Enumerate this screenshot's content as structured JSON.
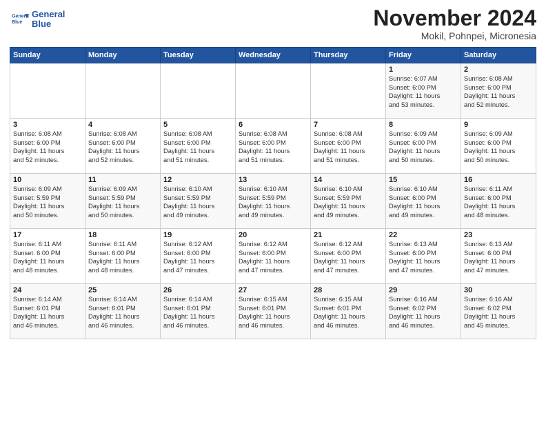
{
  "header": {
    "logo_line1": "General",
    "logo_line2": "Blue",
    "month": "November 2024",
    "location": "Mokil, Pohnpei, Micronesia"
  },
  "weekdays": [
    "Sunday",
    "Monday",
    "Tuesday",
    "Wednesday",
    "Thursday",
    "Friday",
    "Saturday"
  ],
  "weeks": [
    [
      {
        "day": "",
        "info": ""
      },
      {
        "day": "",
        "info": ""
      },
      {
        "day": "",
        "info": ""
      },
      {
        "day": "",
        "info": ""
      },
      {
        "day": "",
        "info": ""
      },
      {
        "day": "1",
        "info": "Sunrise: 6:07 AM\nSunset: 6:00 PM\nDaylight: 11 hours\nand 53 minutes."
      },
      {
        "day": "2",
        "info": "Sunrise: 6:08 AM\nSunset: 6:00 PM\nDaylight: 11 hours\nand 52 minutes."
      }
    ],
    [
      {
        "day": "3",
        "info": "Sunrise: 6:08 AM\nSunset: 6:00 PM\nDaylight: 11 hours\nand 52 minutes."
      },
      {
        "day": "4",
        "info": "Sunrise: 6:08 AM\nSunset: 6:00 PM\nDaylight: 11 hours\nand 52 minutes."
      },
      {
        "day": "5",
        "info": "Sunrise: 6:08 AM\nSunset: 6:00 PM\nDaylight: 11 hours\nand 51 minutes."
      },
      {
        "day": "6",
        "info": "Sunrise: 6:08 AM\nSunset: 6:00 PM\nDaylight: 11 hours\nand 51 minutes."
      },
      {
        "day": "7",
        "info": "Sunrise: 6:08 AM\nSunset: 6:00 PM\nDaylight: 11 hours\nand 51 minutes."
      },
      {
        "day": "8",
        "info": "Sunrise: 6:09 AM\nSunset: 6:00 PM\nDaylight: 11 hours\nand 50 minutes."
      },
      {
        "day": "9",
        "info": "Sunrise: 6:09 AM\nSunset: 6:00 PM\nDaylight: 11 hours\nand 50 minutes."
      }
    ],
    [
      {
        "day": "10",
        "info": "Sunrise: 6:09 AM\nSunset: 5:59 PM\nDaylight: 11 hours\nand 50 minutes."
      },
      {
        "day": "11",
        "info": "Sunrise: 6:09 AM\nSunset: 5:59 PM\nDaylight: 11 hours\nand 50 minutes."
      },
      {
        "day": "12",
        "info": "Sunrise: 6:10 AM\nSunset: 5:59 PM\nDaylight: 11 hours\nand 49 minutes."
      },
      {
        "day": "13",
        "info": "Sunrise: 6:10 AM\nSunset: 5:59 PM\nDaylight: 11 hours\nand 49 minutes."
      },
      {
        "day": "14",
        "info": "Sunrise: 6:10 AM\nSunset: 5:59 PM\nDaylight: 11 hours\nand 49 minutes."
      },
      {
        "day": "15",
        "info": "Sunrise: 6:10 AM\nSunset: 6:00 PM\nDaylight: 11 hours\nand 49 minutes."
      },
      {
        "day": "16",
        "info": "Sunrise: 6:11 AM\nSunset: 6:00 PM\nDaylight: 11 hours\nand 48 minutes."
      }
    ],
    [
      {
        "day": "17",
        "info": "Sunrise: 6:11 AM\nSunset: 6:00 PM\nDaylight: 11 hours\nand 48 minutes."
      },
      {
        "day": "18",
        "info": "Sunrise: 6:11 AM\nSunset: 6:00 PM\nDaylight: 11 hours\nand 48 minutes."
      },
      {
        "day": "19",
        "info": "Sunrise: 6:12 AM\nSunset: 6:00 PM\nDaylight: 11 hours\nand 47 minutes."
      },
      {
        "day": "20",
        "info": "Sunrise: 6:12 AM\nSunset: 6:00 PM\nDaylight: 11 hours\nand 47 minutes."
      },
      {
        "day": "21",
        "info": "Sunrise: 6:12 AM\nSunset: 6:00 PM\nDaylight: 11 hours\nand 47 minutes."
      },
      {
        "day": "22",
        "info": "Sunrise: 6:13 AM\nSunset: 6:00 PM\nDaylight: 11 hours\nand 47 minutes."
      },
      {
        "day": "23",
        "info": "Sunrise: 6:13 AM\nSunset: 6:00 PM\nDaylight: 11 hours\nand 47 minutes."
      }
    ],
    [
      {
        "day": "24",
        "info": "Sunrise: 6:14 AM\nSunset: 6:01 PM\nDaylight: 11 hours\nand 46 minutes."
      },
      {
        "day": "25",
        "info": "Sunrise: 6:14 AM\nSunset: 6:01 PM\nDaylight: 11 hours\nand 46 minutes."
      },
      {
        "day": "26",
        "info": "Sunrise: 6:14 AM\nSunset: 6:01 PM\nDaylight: 11 hours\nand 46 minutes."
      },
      {
        "day": "27",
        "info": "Sunrise: 6:15 AM\nSunset: 6:01 PM\nDaylight: 11 hours\nand 46 minutes."
      },
      {
        "day": "28",
        "info": "Sunrise: 6:15 AM\nSunset: 6:01 PM\nDaylight: 11 hours\nand 46 minutes."
      },
      {
        "day": "29",
        "info": "Sunrise: 6:16 AM\nSunset: 6:02 PM\nDaylight: 11 hours\nand 46 minutes."
      },
      {
        "day": "30",
        "info": "Sunrise: 6:16 AM\nSunset: 6:02 PM\nDaylight: 11 hours\nand 45 minutes."
      }
    ]
  ]
}
